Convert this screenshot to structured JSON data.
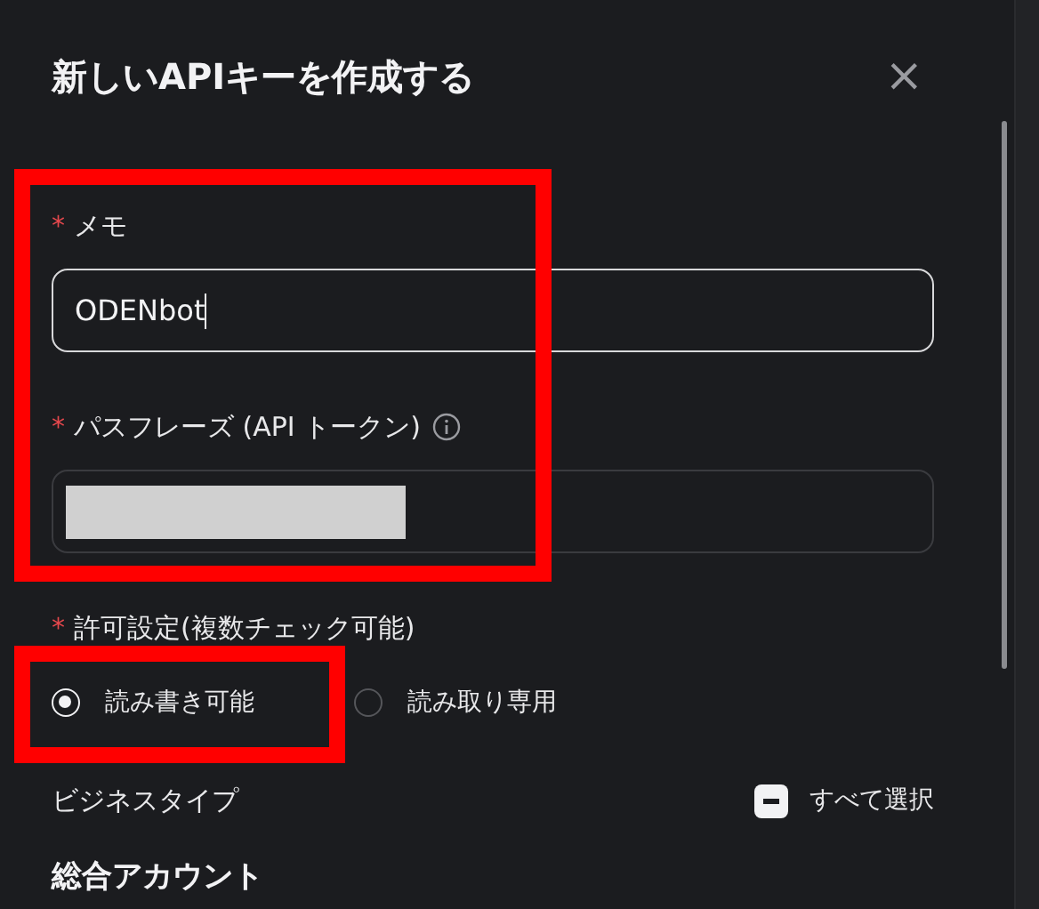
{
  "title": "新しいAPIキーを作成する",
  "close": "×",
  "fields": [
    {
      "required_mark": "*",
      "label": "メモ",
      "value": "ODENbot",
      "focused": true
    },
    {
      "required_mark": "*",
      "label": "パスフレーズ (API トークン)",
      "focused": false,
      "info": true,
      "redacted": true
    }
  ],
  "permissions": {
    "required_mark": "*",
    "label": "許可設定(複数チェック可能)",
    "options": [
      {
        "label": "読み書き可能",
        "selected": true
      },
      {
        "label": "読み取り専用",
        "selected": false
      }
    ]
  },
  "business_type": {
    "label": "ビジネスタイプ",
    "select_all": {
      "label": "すべて選択",
      "indeterminate": true
    }
  },
  "section": "総合アカウント"
}
